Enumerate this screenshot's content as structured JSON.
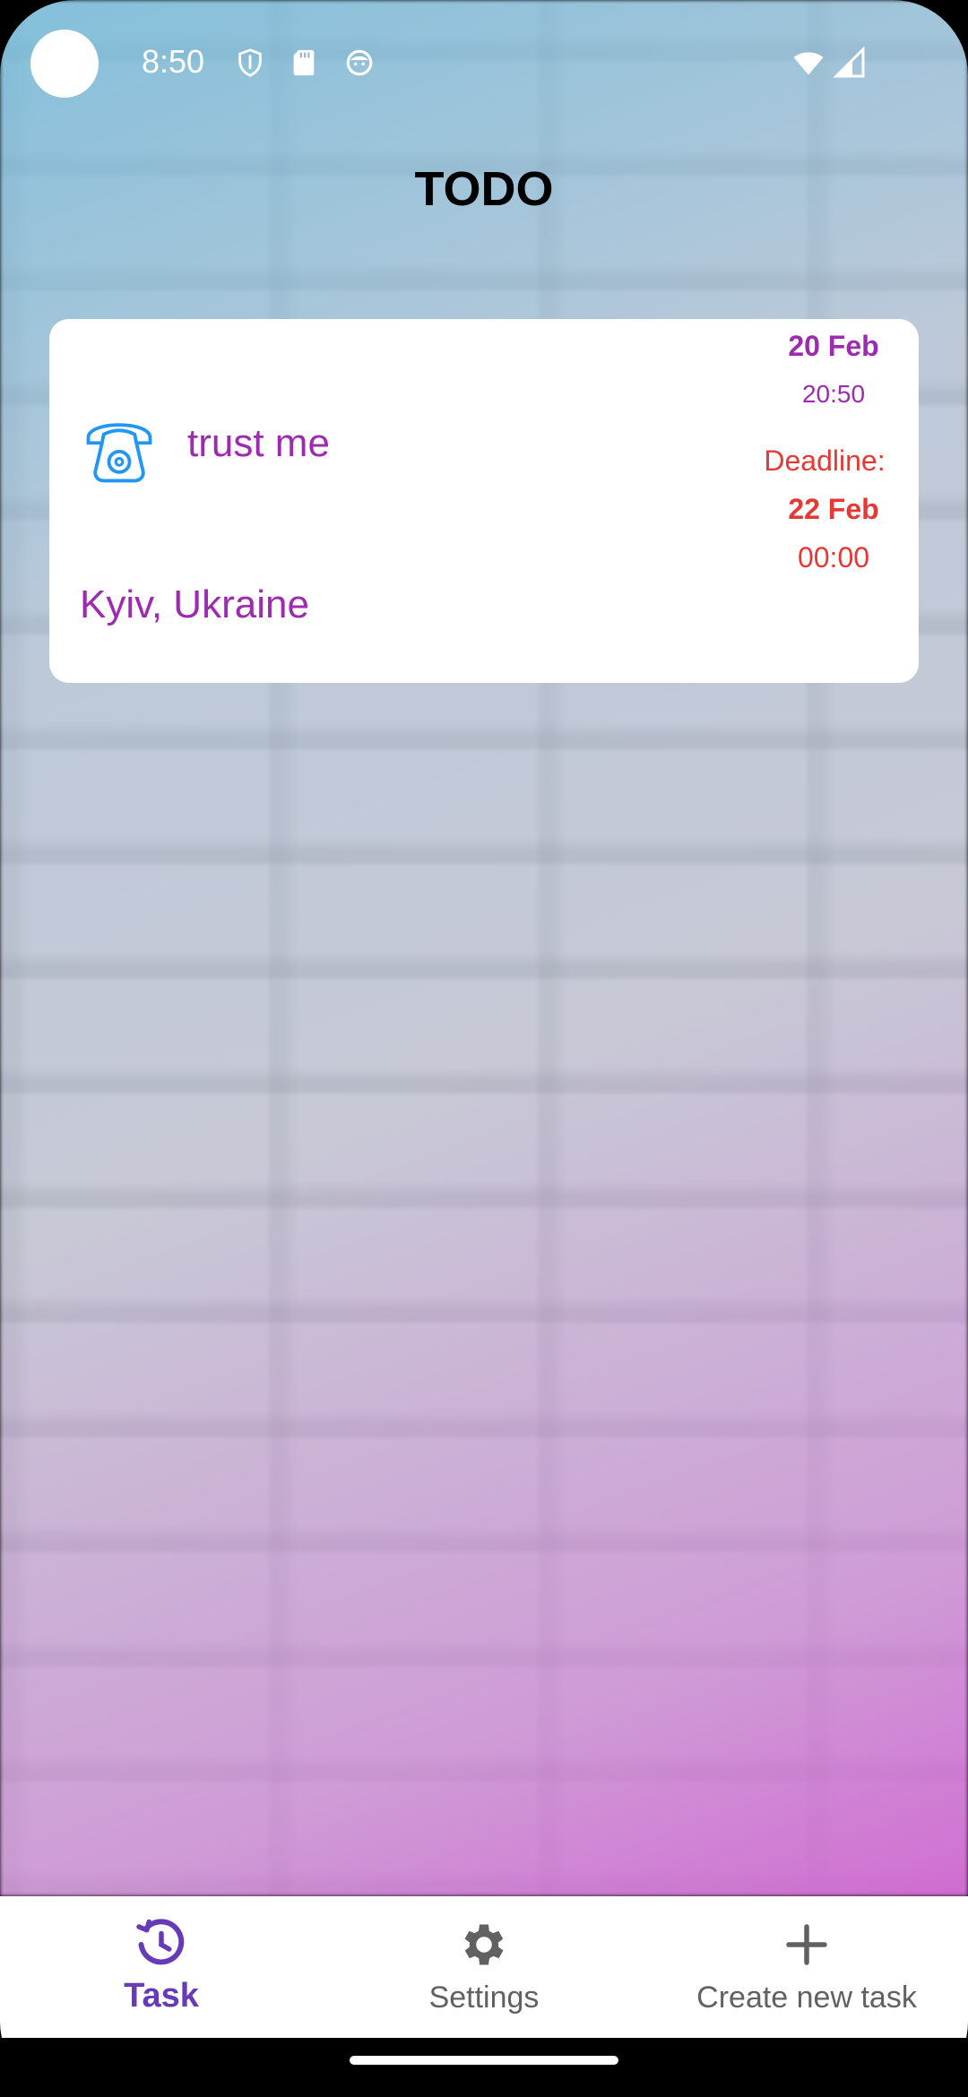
{
  "status_bar": {
    "time": "8:50",
    "icons": [
      "shield-icon",
      "sd-card-icon",
      "face-icon",
      "wifi-icon",
      "signal-icon"
    ]
  },
  "header": {
    "title": "TODO"
  },
  "task_card": {
    "icon": "telephone-icon",
    "name": "trust me",
    "location": "Kyiv, Ukraine",
    "created_date": "20 Feb",
    "created_time": "20:50",
    "deadline_label": "Deadline:",
    "deadline_date": "22 Feb",
    "deadline_time": "00:00"
  },
  "bottom_nav": {
    "items": [
      {
        "label": "Task",
        "icon": "task-clock-icon",
        "active": true
      },
      {
        "label": "Settings",
        "icon": "gear-icon",
        "active": false
      },
      {
        "label": "Create new task",
        "icon": "plus-icon",
        "active": false
      }
    ]
  },
  "colors": {
    "accent": "#673ab7",
    "task_text": "#9c2bb0",
    "deadline": "#e53935",
    "icon_blue": "#2196f3"
  }
}
